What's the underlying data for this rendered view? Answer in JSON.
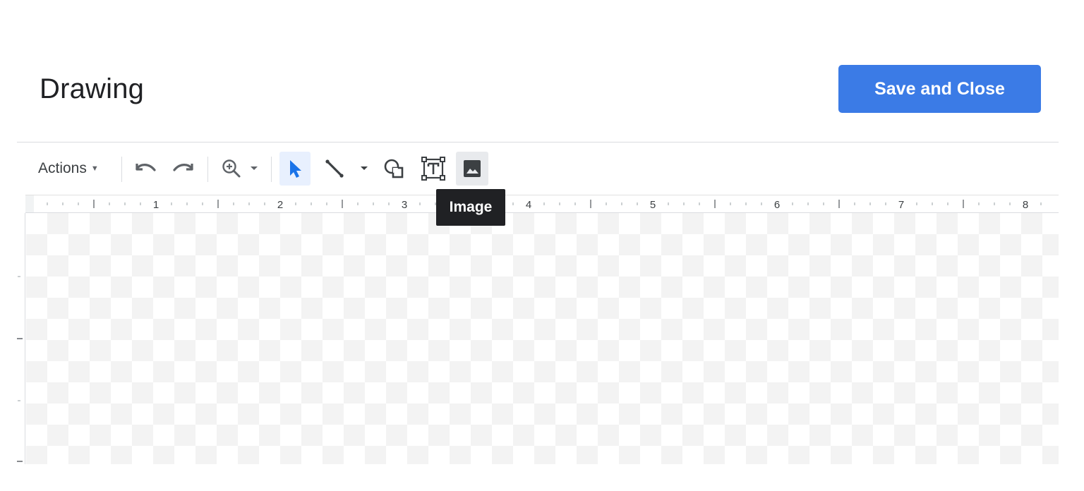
{
  "dialog": {
    "title": "Drawing",
    "save_label": "Save and Close",
    "accent_color": "#3b7be6"
  },
  "toolbar": {
    "actions_label": "Actions",
    "items": [
      {
        "name": "undo",
        "icon": "undo-icon"
      },
      {
        "name": "redo",
        "icon": "redo-icon"
      },
      {
        "name": "zoom",
        "icon": "zoom-in-icon"
      },
      {
        "name": "select",
        "icon": "cursor-arrow-icon",
        "selected": true
      },
      {
        "name": "line",
        "icon": "line-icon"
      },
      {
        "name": "shape",
        "icon": "shape-icon"
      },
      {
        "name": "text-box",
        "icon": "text-box-icon"
      },
      {
        "name": "image",
        "icon": "image-icon",
        "hovered": true
      }
    ]
  },
  "tooltip": {
    "text": "Image"
  },
  "ruler": {
    "labels": [
      "1",
      "2",
      "3",
      "4",
      "5",
      "6",
      "7",
      "8"
    ]
  }
}
